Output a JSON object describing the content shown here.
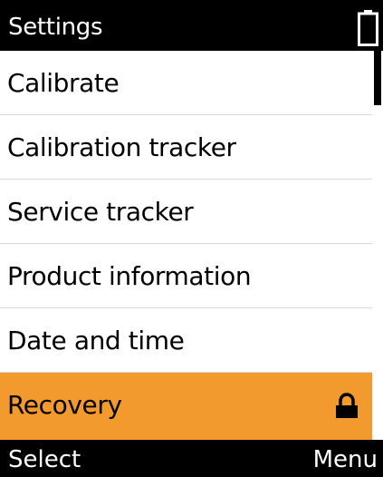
{
  "header": {
    "title": "Settings",
    "battery_icon": "battery-icon"
  },
  "menu": {
    "items": [
      {
        "label": "Calibrate",
        "selected": false
      },
      {
        "label": "Calibration tracker",
        "selected": false
      },
      {
        "label": "Service tracker",
        "selected": false
      },
      {
        "label": "Product information",
        "selected": false
      },
      {
        "label": "Date and time",
        "selected": false
      },
      {
        "label": "Recovery",
        "selected": true,
        "icon": "lock-icon"
      }
    ]
  },
  "softkeys": {
    "left": "Select",
    "right": "Menu"
  },
  "colors": {
    "highlight": "#f29a2e",
    "bar_background": "#000000",
    "list_background": "#ffffff"
  }
}
